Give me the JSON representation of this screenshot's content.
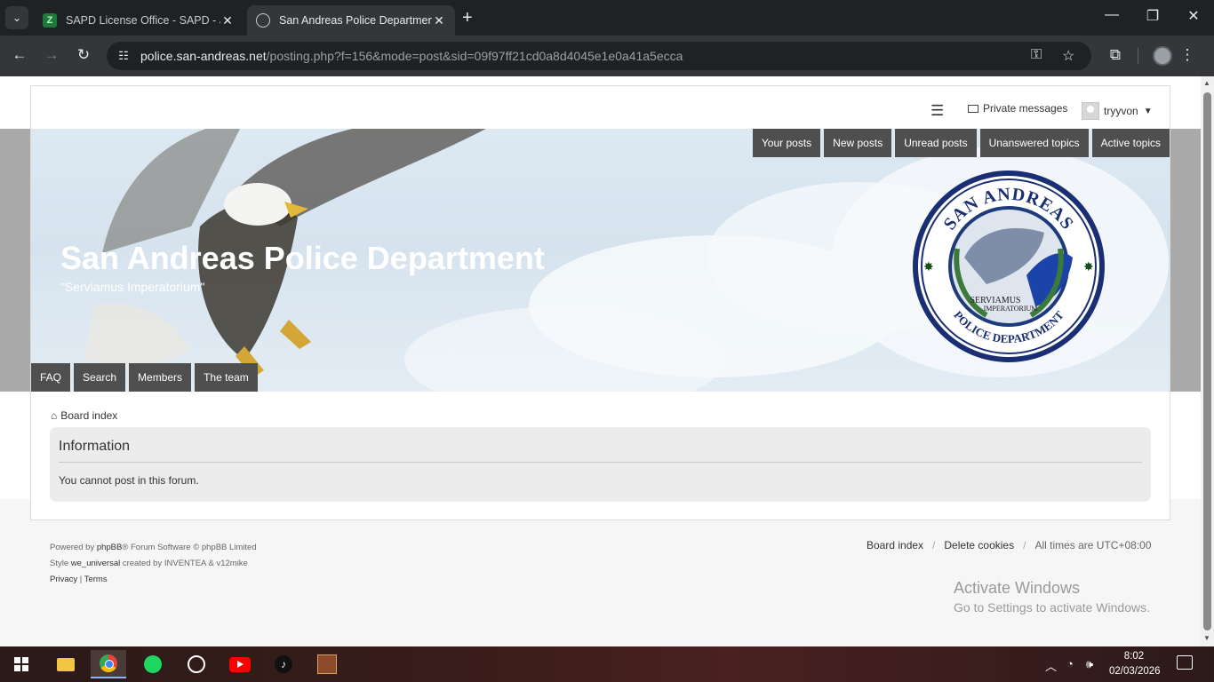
{
  "browser": {
    "tabs": [
      {
        "title": "SAPD License Office - SAPD - Jo",
        "close": "✕"
      },
      {
        "title": "San Andreas Police Department",
        "close": "✕"
      }
    ],
    "new_tab": "+",
    "url_host": "police.san-andreas.net",
    "url_path": "/posting.php?f=156&mode=post&sid=09f97ff21cd0a8d4045e1e0a41a5ecca",
    "window_controls": {
      "minimize": "—",
      "maximize": "❐",
      "close": "✕"
    }
  },
  "forum": {
    "topbar": {
      "private_messages": "Private messages",
      "username": "tryyvon"
    },
    "quick_links": [
      "Your posts",
      "New posts",
      "Unread posts",
      "Unanswered topics",
      "Active topics"
    ],
    "site_title": "San Andreas Police Department",
    "site_description": "\"Serviamus Imperatorium\"",
    "main_nav": [
      "FAQ",
      "Search",
      "Members",
      "The team"
    ],
    "badge": {
      "top_text": "SAN ANDREAS",
      "bottom_text": "POLICE DEPARTMENT",
      "motto_1": "SERVIAMUS",
      "motto_2": "IMPERATORIUM"
    },
    "breadcrumb": "Board index",
    "panel": {
      "title": "Information",
      "message": "You cannot post in this forum."
    },
    "footer": {
      "powered_prefix": "Powered by",
      "phpbb": "phpBB",
      "powered_suffix": "® Forum Software © phpBB Limited",
      "style_prefix": "Style",
      "style_name": "we_universal",
      "style_suffix": "created by INVENTEA & v12mike",
      "privacy": "Privacy",
      "sep": "|",
      "terms": "Terms",
      "links": {
        "board_index": "Board index",
        "delete_cookies": "Delete cookies",
        "timezone": "All times are UTC+08:00",
        "sep": "/"
      }
    }
  },
  "watermark": {
    "line1": "Activate Windows",
    "line2": "Go to Settings to activate Windows."
  },
  "taskbar": {
    "time": "8:02",
    "date": "02/03/2026"
  }
}
